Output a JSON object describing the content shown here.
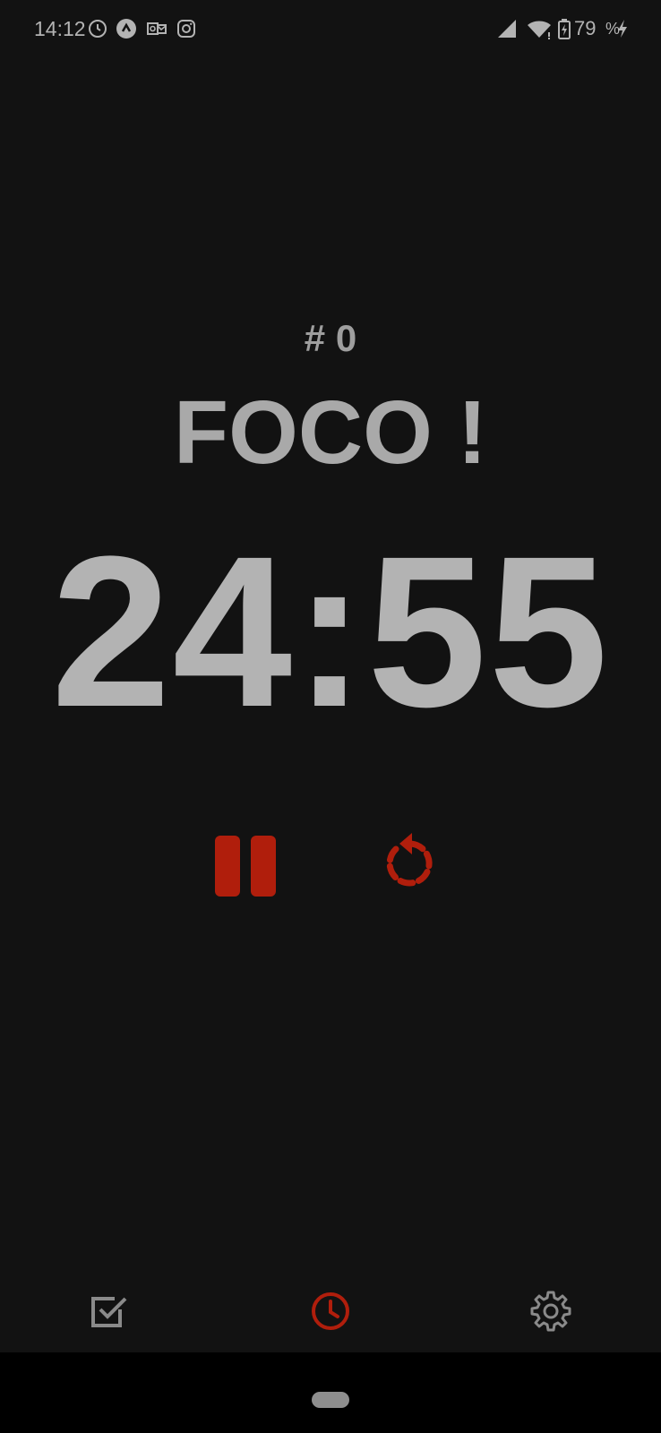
{
  "status_bar": {
    "time": "14:12",
    "battery_level": "79",
    "battery_unit": "%",
    "left_icons": [
      "alarm-clock-icon",
      "app-notification-icon",
      "outlook-icon",
      "instagram-icon"
    ],
    "right_icons": [
      "signal-icon",
      "wifi-icon",
      "battery-charging-icon",
      "charging-bolt-icon"
    ]
  },
  "session": {
    "count_label": "# 0"
  },
  "mode": {
    "title": "FOCO !"
  },
  "timer": {
    "display": "24:55"
  },
  "controls": {
    "pause_icon": "pause-icon",
    "reset_icon": "reset-icon"
  },
  "bottom_nav": {
    "items": [
      {
        "icon": "checklist-icon",
        "active": false
      },
      {
        "icon": "clock-icon",
        "active": true
      },
      {
        "icon": "settings-gear-icon",
        "active": false
      }
    ]
  },
  "colors": {
    "background": "#121212",
    "accent": "#b01e0c",
    "text_primary": "#b3b3b3",
    "icon_inactive": "#8a8a8a",
    "system_bar": "#000000"
  }
}
